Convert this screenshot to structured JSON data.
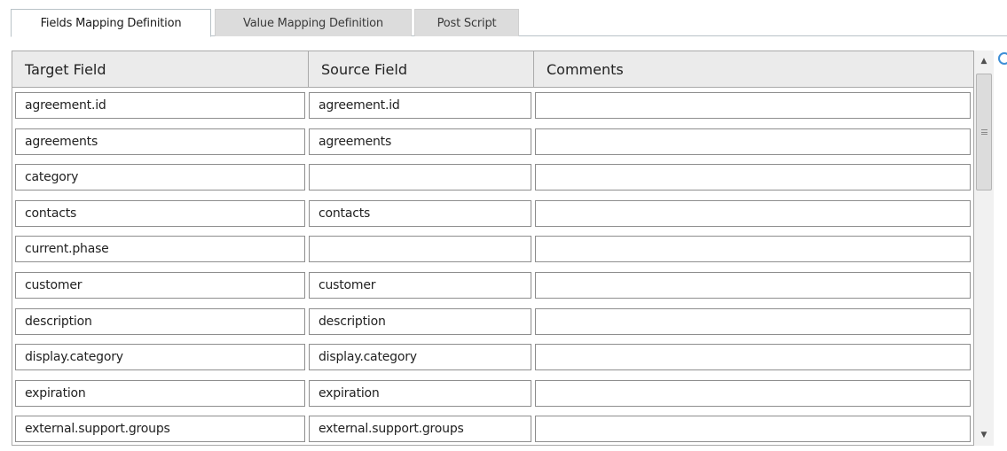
{
  "tabs": [
    {
      "label": "Fields Mapping Definition",
      "active": true
    },
    {
      "label": "Value Mapping Definition",
      "active": false
    },
    {
      "label": "Post Script",
      "active": false
    }
  ],
  "grid": {
    "columns": [
      "Target Field",
      "Source Field",
      "Comments"
    ],
    "rows": [
      {
        "target": "agreement.id",
        "source": "agreement.id",
        "comments": ""
      },
      {
        "target": "agreements",
        "source": "agreements",
        "comments": ""
      },
      {
        "target": "category",
        "source": "",
        "comments": ""
      },
      {
        "target": "contacts",
        "source": "contacts",
        "comments": ""
      },
      {
        "target": "current.phase",
        "source": "",
        "comments": ""
      },
      {
        "target": "customer",
        "source": "customer",
        "comments": ""
      },
      {
        "target": "description",
        "source": "description",
        "comments": ""
      },
      {
        "target": "display.category",
        "source": "display.category",
        "comments": ""
      },
      {
        "target": "expiration",
        "source": "expiration",
        "comments": ""
      },
      {
        "target": "external.support.groups",
        "source": "external.support.groups",
        "comments": ""
      }
    ]
  },
  "scrollbar": {
    "up_icon": "triangle-up-icon",
    "down_icon": "triangle-down-icon",
    "thumb_grip_icon": "grip-lines-icon",
    "position_fraction": 0.0
  },
  "colors": {
    "header_bg": "#ebebeb",
    "border": "#a9a9a9",
    "inactive_tab_bg": "#dcdcdc",
    "edge_icon": "#3f8fd6"
  }
}
